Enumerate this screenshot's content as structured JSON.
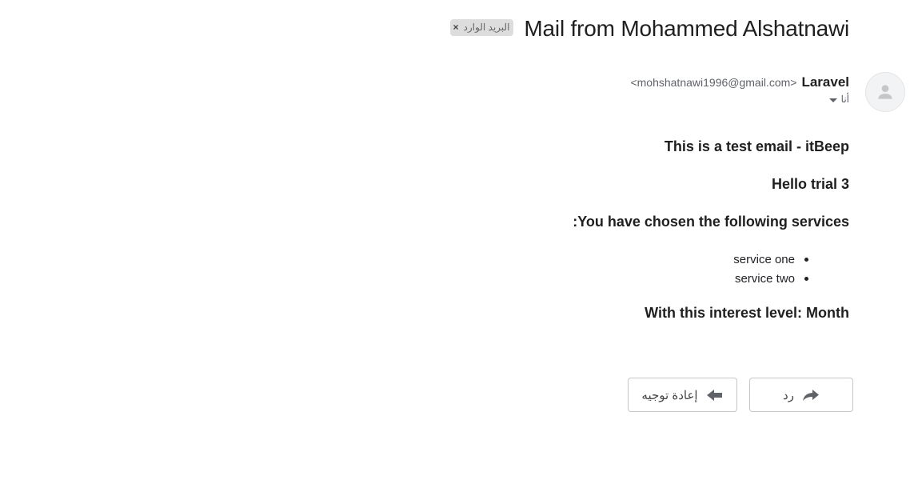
{
  "subject": {
    "title": "Mail from Mohammed Alshatnawi",
    "label_chip": "البريد الوارد",
    "chip_close": "×"
  },
  "sender": {
    "name": "Laravel",
    "email": "<mohshatnawi1996@gmail.com>",
    "recipient": "أنا"
  },
  "body": {
    "heading": "This is a test email - itBeep",
    "greeting": "Hello trial 3",
    "services_intro": ":You have chosen the following services",
    "services": [
      "service one",
      "service two"
    ],
    "interest": "With this interest level: Month"
  },
  "actions": {
    "reply_label": "رد",
    "forward_label": "إعادة توجيه"
  },
  "icons": {
    "avatar": "person-icon",
    "reply": "reply-arrow-icon",
    "forward": "forward-arrow-icon",
    "recipient_dropdown": "caret-down-icon"
  }
}
